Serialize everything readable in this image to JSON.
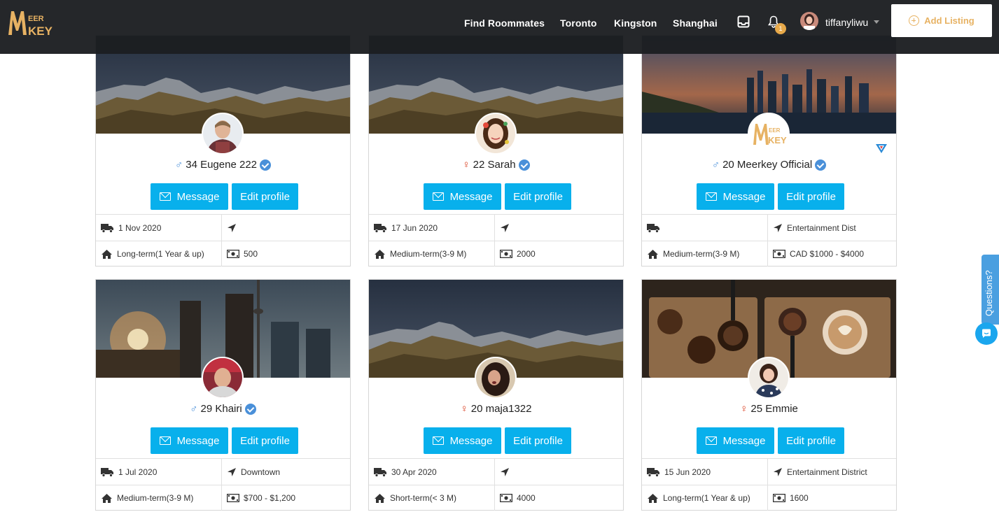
{
  "header": {
    "logo_alt": "MeerKey",
    "nav": [
      "Find Roommates",
      "Toronto",
      "Kingston",
      "Shanghai"
    ],
    "notification_count": "1",
    "username": "tiffanyliwu",
    "add_listing": "Add Listing"
  },
  "colors": {
    "accent": "#08b0ec",
    "brand_gold": "#e7b263",
    "navbar": "#1c1e21",
    "male": "#4a90d9",
    "female": "#d93b1c"
  },
  "cards": [
    {
      "gender": "male",
      "gender_symbol": "♂",
      "name": "34 Eugene 222",
      "verified": true,
      "message": "Message",
      "edit": "Edit profile",
      "move_in": "1 Nov 2020",
      "location": "",
      "term": "Long-term(1 Year & up)",
      "budget": "500",
      "cover": "mountains"
    },
    {
      "gender": "female",
      "gender_symbol": "♀",
      "name": "22 Sarah",
      "verified": true,
      "message": "Message",
      "edit": "Edit profile",
      "move_in": "17 Jun 2020",
      "location": "",
      "term": "Medium-term(3-9 M)",
      "budget": "2000",
      "cover": "mountains"
    },
    {
      "gender": "male",
      "gender_symbol": "♂",
      "name": "20 Meerkey Official",
      "verified": true,
      "message": "Message",
      "edit": "Edit profile",
      "move_in": "",
      "location": "Entertainment Dist",
      "term": "Medium-term(3-9 M)",
      "budget": "CAD $1000 - $4000",
      "cover": "city"
    },
    {
      "gender": "male",
      "gender_symbol": "♂",
      "name": "29 Khairi",
      "verified": true,
      "message": "Message",
      "edit": "Edit profile",
      "move_in": "1 Jul 2020",
      "location": "Downtown",
      "term": "Medium-term(3-9 M)",
      "budget": "$700 - $1,200",
      "cover": "toronto"
    },
    {
      "gender": "female",
      "gender_symbol": "♀",
      "name": "20 maja1322",
      "verified": false,
      "message": "Message",
      "edit": "Edit profile",
      "move_in": "30 Apr 2020",
      "location": "",
      "term": "Short-term(< 3 M)",
      "budget": "4000",
      "cover": "mountains"
    },
    {
      "gender": "female",
      "gender_symbol": "♀",
      "name": "25 Emmie",
      "verified": false,
      "message": "Message",
      "edit": "Edit profile",
      "move_in": "15 Jun 2020",
      "location": "Entertainment District",
      "term": "Long-term(1 Year & up)",
      "budget": "1600",
      "cover": "coffee"
    }
  ],
  "support": {
    "questions_label": "Questions?"
  }
}
